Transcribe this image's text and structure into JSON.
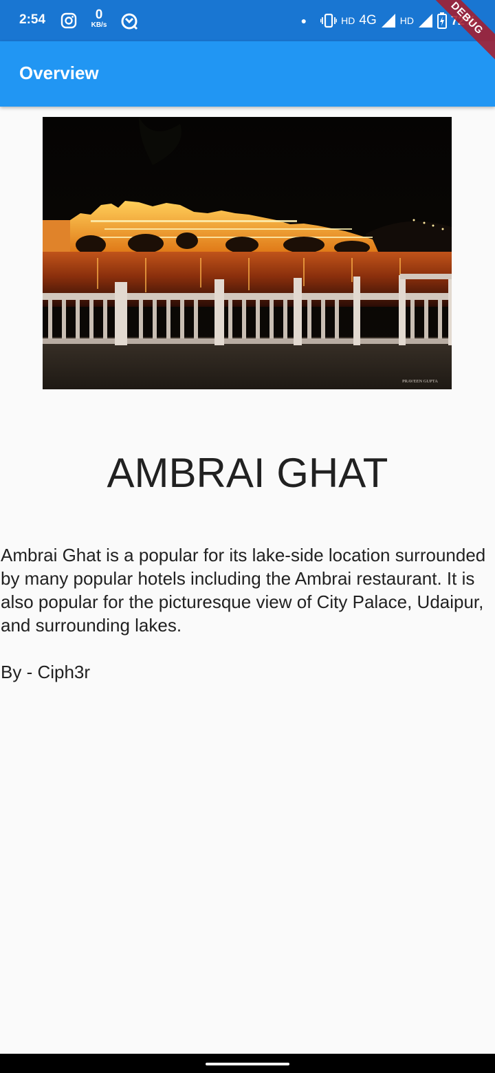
{
  "status_bar": {
    "time": "2:54",
    "net_speed_value": "0",
    "net_speed_unit": "KB/s",
    "hd1": "HD",
    "network": "4G",
    "hd2": "HD",
    "battery": "72%",
    "icons": [
      "instagram-icon",
      "data-saver-icon",
      "notification-dot-icon",
      "vibrate-icon",
      "signal-icon",
      "battery-charging-icon"
    ]
  },
  "debug_banner": "DEBUG",
  "app_bar": {
    "title": "Overview",
    "color": "#2196f3"
  },
  "place": {
    "image_credit": "PRAVEEN GUPTA",
    "name": "AMBRAI GHAT",
    "description": "Ambrai Ghat is a popular for its lake-side location surrounded by many popular hotels including the Ambrai restaurant. It is also popular for the picturesque view of City Palace, Udaipur, and surrounding lakes.",
    "author": "By - Ciph3r"
  },
  "colors": {
    "status_bar": "#1976d2",
    "app_bar": "#2196f3",
    "background": "#fafafa",
    "text": "#212121"
  }
}
